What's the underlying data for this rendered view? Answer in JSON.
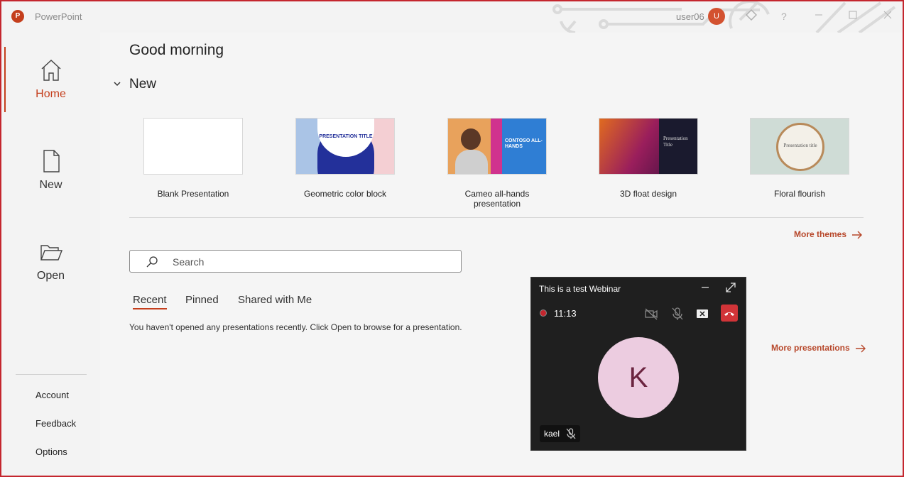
{
  "titlebar": {
    "app_name": "PowerPoint",
    "app_logo_letter": "P",
    "user_name": "user06",
    "avatar_letter": "U",
    "help": "?"
  },
  "sidebar": {
    "items": [
      {
        "label": "Home",
        "icon": "home-icon",
        "active": true
      },
      {
        "label": "New",
        "icon": "new-file-icon",
        "active": false
      },
      {
        "label": "Open",
        "icon": "folder-open-icon",
        "active": false
      }
    ],
    "bottom_links": [
      "Account",
      "Feedback",
      "Options"
    ]
  },
  "main": {
    "greeting": "Good morning",
    "new_heading": "New",
    "templates": [
      {
        "name": "Blank Presentation"
      },
      {
        "name": "Geometric color block",
        "thumb_text": "PRESENTATION TITLE"
      },
      {
        "name": "Cameo all-hands presentation",
        "thumb_text": "CONTOSO ALL-HANDS"
      },
      {
        "name": "3D float design",
        "thumb_text": "Presentation Title"
      },
      {
        "name": "Floral flourish",
        "thumb_text": "Presentation title"
      }
    ],
    "more_themes": "More themes",
    "search_placeholder": "Search",
    "tabs": [
      "Recent",
      "Pinned",
      "Shared with Me"
    ],
    "empty_message": "You haven't opened any presentations recently. Click Open to browse for a presentation.",
    "more_presentations": "More presentations"
  },
  "webinar": {
    "title": "This is a test Webinar",
    "time": "11:13",
    "avatar_letter": "K",
    "participant_name": "kael"
  },
  "colors": {
    "accent": "#c43e1c",
    "link": "#b7472a",
    "frame": "#c4262e",
    "hangup": "#d13438"
  }
}
